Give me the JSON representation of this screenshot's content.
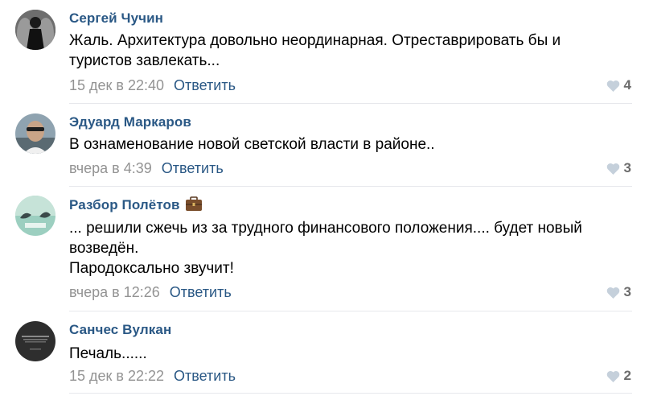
{
  "comments": [
    {
      "author": "Сергей Чучин",
      "text_lines": [
        "Жаль. Архитектура довольно неординарная. Отреставрировать бы и",
        "туристов завлекать..."
      ],
      "date": "15 дек в 22:40",
      "reply_label": "Ответить",
      "likes": "4",
      "avatar": "avatar-dark-figure"
    },
    {
      "author": "Эдуард Маркаров",
      "text_lines": [
        "В ознаменование новой светской власти в районе.."
      ],
      "date": "вчера в 4:39",
      "reply_label": "Ответить",
      "likes": "3",
      "avatar": "avatar-man-sunglasses"
    },
    {
      "author": "Разбор Полётов",
      "author_badge": "briefcase-icon",
      "text_lines": [
        "... решили сжечь из за трудного финансового положения.... будет новый",
        "возведён.",
        "Пародоксально звучит!"
      ],
      "date": "вчера в 12:26",
      "reply_label": "Ответить",
      "likes": "3",
      "avatar": "avatar-birds-teal"
    },
    {
      "author": "Санчес Вулкан",
      "text_lines": [
        "Печаль......"
      ],
      "date": "15 дек в 22:22",
      "reply_label": "Ответить",
      "likes": "2",
      "avatar": "avatar-dark-quote"
    }
  ],
  "colors": {
    "author": "#2a5885",
    "link": "#2a5885",
    "date": "#939393",
    "like_count": "#6c6c6c",
    "heart": "#c5d0db",
    "divider": "#e7e8ec"
  }
}
